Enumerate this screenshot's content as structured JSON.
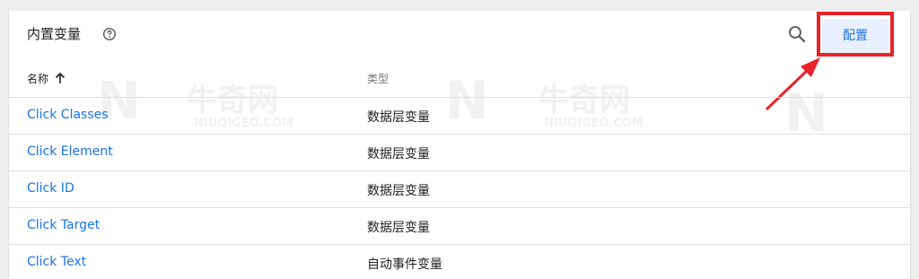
{
  "header": {
    "title": "内置变量",
    "config_label": "配置"
  },
  "table": {
    "columns": {
      "name": "名称",
      "type": "类型"
    },
    "rows": [
      {
        "name": "Click Classes",
        "type": "数据层变量"
      },
      {
        "name": "Click Element",
        "type": "数据层变量"
      },
      {
        "name": "Click ID",
        "type": "数据层变量"
      },
      {
        "name": "Click Target",
        "type": "数据层变量"
      },
      {
        "name": "Click Text",
        "type": "自动事件变量"
      }
    ]
  },
  "watermark": {
    "brand": "牛奇网",
    "domain": "NIUQIGEO.COM"
  },
  "colors": {
    "accent": "#1a73e8",
    "highlight": "#e8232a",
    "button_bg": "#e8f0fe"
  }
}
